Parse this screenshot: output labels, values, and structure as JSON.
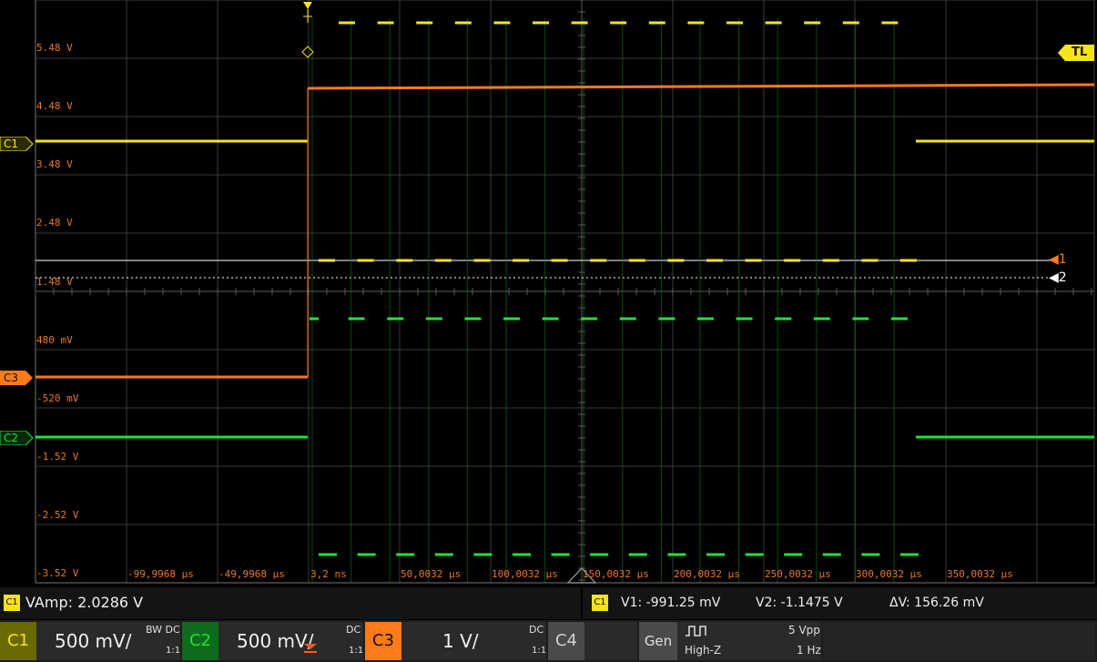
{
  "y_labels": [
    "5.48 V",
    "4.48 V",
    "3.48 V",
    "2.48 V",
    "1.48 V",
    "480 mV",
    "-520 mV",
    "-1.52 V",
    "-2.52 V",
    "-3.52 V"
  ],
  "x_labels": [
    "-99,9968 µs",
    "-49,9968 µs",
    "3,2 ns",
    "50,0032 µs",
    "100,0032 µs",
    "150,0032 µs",
    "200,0032 µs",
    "250,0032 µs",
    "300,0032 µs",
    "350,0032 µs"
  ],
  "markers": {
    "trigger_level": "TL",
    "cursor1": "1",
    "cursor2": "2"
  },
  "channel_markers": {
    "c1": "C1",
    "c3": "C3",
    "c2": "C2"
  },
  "colors": {
    "c1": "#f5e321",
    "c2": "#1ee33a",
    "c3": "#ff7a1a",
    "label": "#e8762d",
    "grid": "#3a3a3a"
  },
  "measurements": {
    "left_tag": "C1",
    "vamp": "VAmp: 2.0286 V",
    "right_tag": "C1",
    "v1": "V1: -991.25 mV",
    "v2": "V2: -1.1475 V",
    "dv": "ΔV: 156.26 mV"
  },
  "channels": [
    {
      "tag": "C1",
      "scale": "500 mV/",
      "coupling": "BW DC",
      "probe": "1:1"
    },
    {
      "tag": "C2",
      "scale": "500 mV/",
      "coupling": "DC",
      "probe": "1:1"
    },
    {
      "tag": "C3",
      "scale": "1 V/",
      "coupling": "DC",
      "probe": "1:1"
    },
    {
      "tag": "C4"
    }
  ],
  "generator": {
    "label": "Gen",
    "amplitude": "5 Vpp",
    "impedance": "High-Z",
    "frequency": "1 Hz"
  }
}
